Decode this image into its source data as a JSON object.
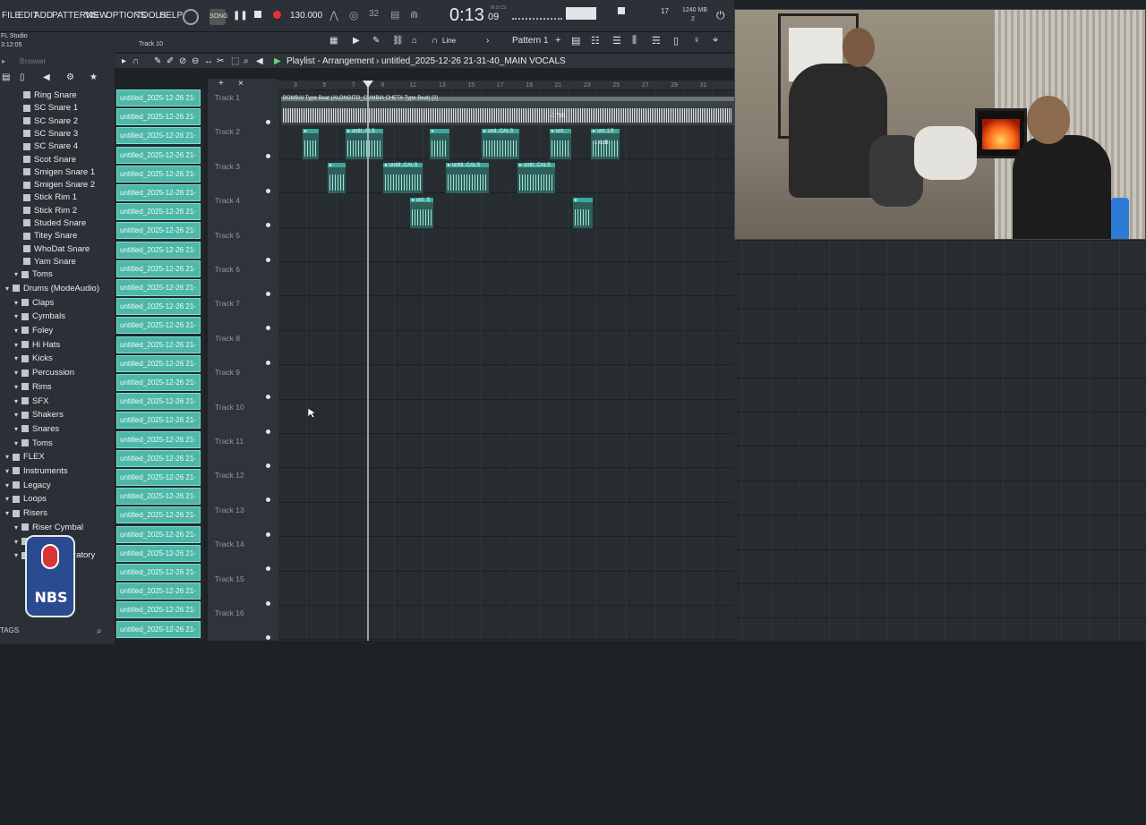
{
  "menu": [
    "FILE",
    "EDIT",
    "ADD",
    "PATTERNS",
    "VIEW",
    "OPTIONS",
    "TOOLS",
    "HELP"
  ],
  "transport": {
    "tempo": "130.000",
    "time": "0:13",
    "time_frac": "09",
    "mics_label": "M:S:CS",
    "mem": "1240 MB",
    "cpu_count": "17",
    "voices": "2"
  },
  "app": {
    "name": "FL Studio",
    "version": "3:12:05",
    "hint": "Track 10"
  },
  "toolbar": {
    "snap": "Line",
    "pattern": "Pattern 1"
  },
  "browser": {
    "title": "Browser",
    "tags_label": "TAGS"
  },
  "playlist": {
    "title": "Playlist - Arrangement",
    "path": "untitled_2025-12-26 21-31-40_MAIN VOCALS"
  },
  "tree": [
    {
      "label": "Ring Snare",
      "level": 2,
      "folder": false
    },
    {
      "label": "SC Snare 1",
      "level": 2,
      "folder": false
    },
    {
      "label": "SC Snare 2",
      "level": 2,
      "folder": false
    },
    {
      "label": "SC Snare 3",
      "level": 2,
      "folder": false
    },
    {
      "label": "SC Snare 4",
      "level": 2,
      "folder": false
    },
    {
      "label": "Scot Snare",
      "level": 2,
      "folder": false
    },
    {
      "label": "Smigen Snare 1",
      "level": 2,
      "folder": false
    },
    {
      "label": "Smigen Snare 2",
      "level": 2,
      "folder": false
    },
    {
      "label": "Stick Rim 1",
      "level": 2,
      "folder": false
    },
    {
      "label": "Stick Rim 2",
      "level": 2,
      "folder": false
    },
    {
      "label": "Studed Snare",
      "level": 2,
      "folder": false
    },
    {
      "label": "Titey Snare",
      "level": 2,
      "folder": false
    },
    {
      "label": "WhoDat Snare",
      "level": 2,
      "folder": false
    },
    {
      "label": "Yam Snare",
      "level": 2,
      "folder": false
    },
    {
      "label": "Toms",
      "level": 1,
      "folder": true
    },
    {
      "label": "Drums (ModeAudio)",
      "level": 0,
      "folder": true
    },
    {
      "label": "Claps",
      "level": 1,
      "folder": true
    },
    {
      "label": "Cymbals",
      "level": 1,
      "folder": true
    },
    {
      "label": "Foley",
      "level": 1,
      "folder": true
    },
    {
      "label": "Hi Hats",
      "level": 1,
      "folder": true
    },
    {
      "label": "Kicks",
      "level": 1,
      "folder": true
    },
    {
      "label": "Percussion",
      "level": 1,
      "folder": true
    },
    {
      "label": "Rims",
      "level": 1,
      "folder": true
    },
    {
      "label": "SFX",
      "level": 1,
      "folder": true
    },
    {
      "label": "Shakers",
      "level": 1,
      "folder": true
    },
    {
      "label": "Snares",
      "level": 1,
      "folder": true
    },
    {
      "label": "Toms",
      "level": 1,
      "folder": true
    },
    {
      "label": "FLEX",
      "level": 0,
      "folder": true
    },
    {
      "label": "Instruments",
      "level": 0,
      "folder": true
    },
    {
      "label": "Legacy",
      "level": 0,
      "folder": true
    },
    {
      "label": "Loops",
      "level": 0,
      "folder": true
    },
    {
      "label": "Risers",
      "level": 0,
      "folder": true
    },
    {
      "label": "Riser Cymbal",
      "level": 1,
      "folder": true
    },
    {
      "label": "ng",
      "level": 1,
      "folder": true
    },
    {
      "label": "Riser Laboratory",
      "level": 1,
      "folder": true
    }
  ],
  "clip_label": "untitled_2025-12-26 21-",
  "clip_count": 29,
  "tracks": [
    "Track 1",
    "Track 2",
    "Track 3",
    "Track 4",
    "Track 5",
    "Track 6",
    "Track 7",
    "Track 8",
    "Track 9",
    "Track 10",
    "Track 11",
    "Track 12",
    "Track 13",
    "Track 14",
    "Track 15",
    "Track 16"
  ],
  "ruler": [
    "3",
    "5",
    "7",
    "9",
    "11",
    "13",
    "15",
    "17",
    "19",
    "21",
    "23",
    "25",
    "27",
    "29",
    "31"
  ],
  "beat_clip": {
    "label": "BOMBAI Type Beat (ALONGITO_CUMBIA CHETA Type Beat) [2]",
    "gain": "-0.7dB"
  },
  "small_clips": [
    {
      "label": "",
      "track": 1
    },
    {
      "label": "untit..ALS",
      "track": 1
    },
    {
      "label": "",
      "track": 1
    },
    {
      "label": "unti..CALS",
      "track": 1
    },
    {
      "label": "unt..",
      "track": 1
    },
    {
      "label": "unt..LS",
      "track": 1,
      "gain": "-1.6dB"
    },
    {
      "label": "",
      "track": 2
    },
    {
      "label": "untitl..CALS",
      "track": 2
    },
    {
      "label": "untitl..CALS",
      "track": 2
    },
    {
      "label": "untit..CALS",
      "track": 2
    },
    {
      "label": "unt..S",
      "track": 3
    },
    {
      "label": "",
      "track": 3
    }
  ],
  "colors": {
    "clip": "#4fb7a8",
    "accent": "#3aa89a",
    "bg": "#262c30"
  }
}
